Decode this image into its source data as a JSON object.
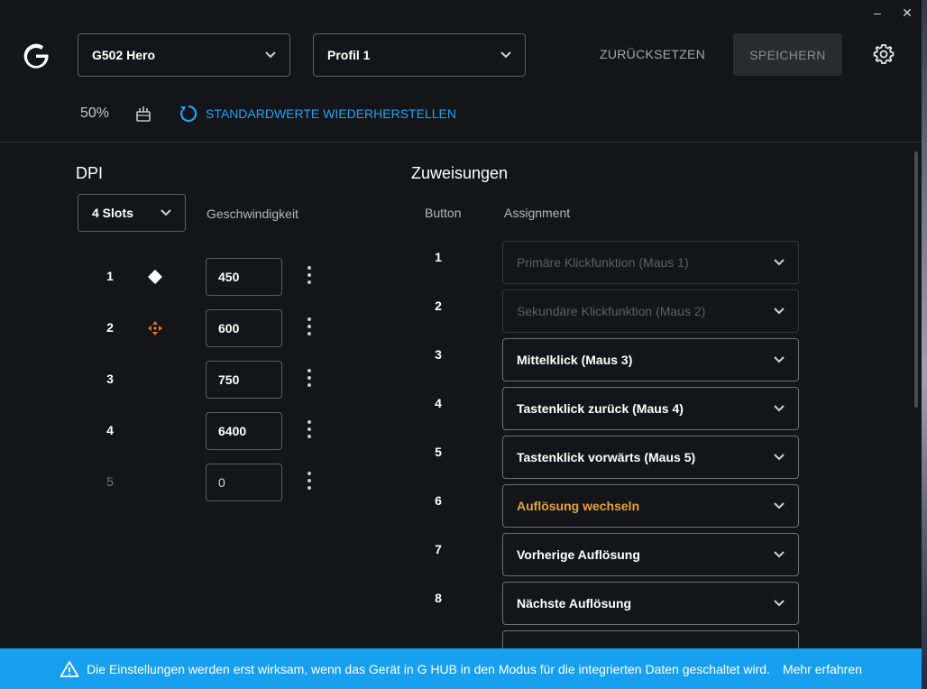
{
  "window": {
    "minimize": "–",
    "close": "✕"
  },
  "header": {
    "device": "G502 Hero",
    "profile": "Profil 1",
    "reset_label": "ZURÜCKSETZEN",
    "save_label": "SPEICHERN",
    "battery": "50%",
    "restore_label": "STANDARDWERTE WIEDERHERSTELLEN"
  },
  "dpi": {
    "title": "DPI",
    "slots_select": "4 Slots",
    "speed_header": "Geschwindigkeit",
    "slots": [
      {
        "num": "1",
        "value": "450",
        "icon": "diamond-icon"
      },
      {
        "num": "2",
        "value": "600",
        "icon": "dpi-shift-icon"
      },
      {
        "num": "3",
        "value": "750",
        "icon": ""
      },
      {
        "num": "4",
        "value": "6400",
        "icon": ""
      },
      {
        "num": "5",
        "value": "0",
        "icon": ""
      }
    ]
  },
  "assignments": {
    "title": "Zuweisungen",
    "col_button": "Button",
    "col_assignment": "Assignment",
    "rows": [
      {
        "num": "1",
        "label": "Primäre Klickfunktion (Maus 1)",
        "state": "disabled"
      },
      {
        "num": "2",
        "label": "Sekundäre Klickfunktion (Maus 2)",
        "state": "disabled"
      },
      {
        "num": "3",
        "label": "Mittelklick (Maus 3)",
        "state": "normal"
      },
      {
        "num": "4",
        "label": "Tastenklick zurück (Maus 4)",
        "state": "normal"
      },
      {
        "num": "5",
        "label": "Tastenklick vorwärts (Maus 5)",
        "state": "normal"
      },
      {
        "num": "6",
        "label": "Auflösung wechseln",
        "state": "highlight"
      },
      {
        "num": "7",
        "label": "Vorherige Auflösung",
        "state": "normal"
      },
      {
        "num": "8",
        "label": "Nächste Auflösung",
        "state": "normal"
      }
    ]
  },
  "banner": {
    "message": "Die Einstellungen werden erst wirksam, wenn das Gerät in G HUB in den Modus für die integrierten Daten geschaltet wird.",
    "link": "Mehr erfahren"
  },
  "colors": {
    "accent": "#1fa2f5",
    "highlight": "#e4a43a",
    "dpi_shift": "#e8742c",
    "banner": "#17a0f0"
  }
}
